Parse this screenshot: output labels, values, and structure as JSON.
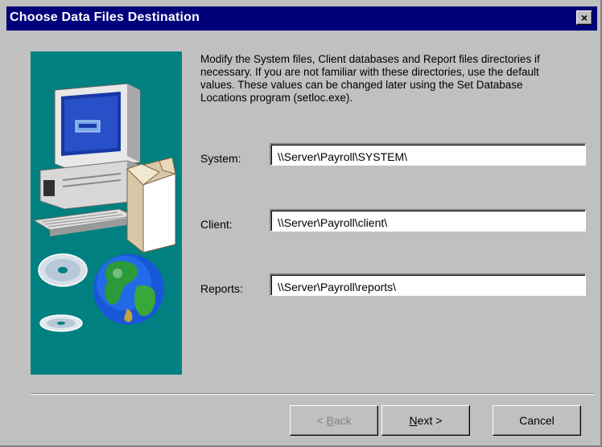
{
  "window": {
    "title": "Choose Data Files Destination",
    "close_glyph": "×"
  },
  "description": "Modify the System files, Client databases and Report files directories if necessary.  If you are not familiar with these directories, use the default values.  These values can be changed later using the Set Database Locations program (setloc.exe).",
  "fields": {
    "system": {
      "label": "System:",
      "value": "\\\\Server\\Payroll\\SYSTEM\\"
    },
    "client": {
      "label": "Client:",
      "value": "\\\\Server\\Payroll\\client\\"
    },
    "reports": {
      "label": "Reports:",
      "value": "\\\\Server\\Payroll\\reports\\"
    }
  },
  "buttons": {
    "back": {
      "prefix": "< ",
      "mnemonic": "B",
      "rest": "ack",
      "enabled": false
    },
    "next": {
      "mnemonic": "N",
      "rest": "ext",
      "suffix": " >"
    },
    "cancel": {
      "label": "Cancel"
    }
  },
  "colors": {
    "title_bar": "#00007b",
    "art_background": "#008080",
    "dialog_face": "#c0c0c0"
  },
  "icons": [
    "close-icon",
    "computer-icon",
    "cd-disc-icon",
    "globe-icon"
  ]
}
